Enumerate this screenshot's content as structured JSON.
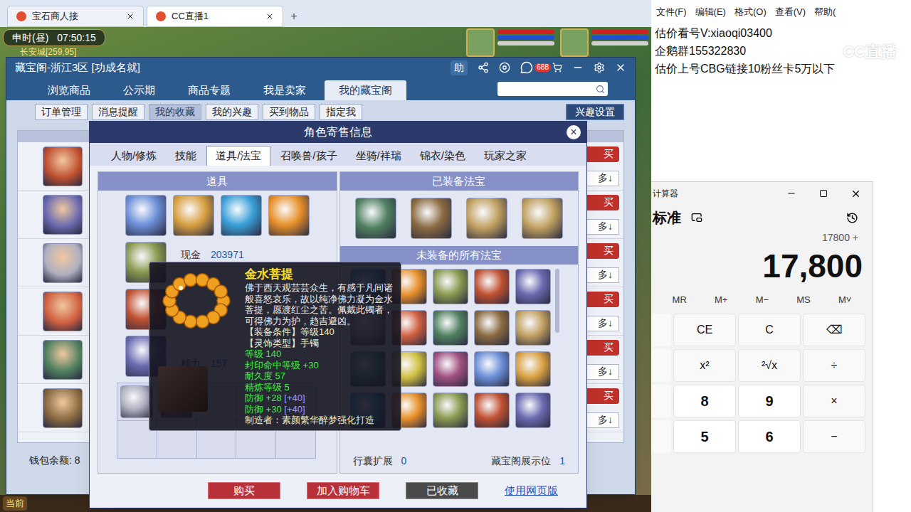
{
  "browser": {
    "tabs": [
      {
        "label": "宝石商人接",
        "selected": false
      },
      {
        "label": "CC直播1",
        "selected": true
      }
    ],
    "new_tab": "+"
  },
  "game_hud": {
    "time": "申时(昼)",
    "clock": "07:50:15",
    "location": "长安城[259,95]"
  },
  "cbg": {
    "title": "藏宝阁-浙江3区 [功成名就]",
    "help": "助",
    "badge": "688",
    "tabs": [
      {
        "label": "浏览商品",
        "selected": false
      },
      {
        "label": "公示期",
        "selected": false
      },
      {
        "label": "商品专题",
        "selected": false
      },
      {
        "label": "我是卖家",
        "selected": false
      },
      {
        "label": "我的藏宝阁",
        "selected": true
      }
    ],
    "subtabs": [
      {
        "label": "订单管理",
        "selected": false
      },
      {
        "label": "消息提醒",
        "selected": false
      },
      {
        "label": "我的收藏",
        "selected": true
      },
      {
        "label": "我的兴趣",
        "selected": false
      },
      {
        "label": "买到物品",
        "selected": false
      },
      {
        "label": "指定我",
        "selected": false
      }
    ],
    "interest_button": "兴趣设置",
    "search": {
      "placeholder": ""
    },
    "rows": [
      {
        "buy": "买",
        "more": "多↓"
      },
      {
        "buy": "买",
        "more": "多↓"
      },
      {
        "buy": "买",
        "more": "多↓"
      },
      {
        "buy": "买",
        "more": "多↓"
      },
      {
        "buy": "买",
        "more": "多↓"
      },
      {
        "buy": "买",
        "more": "多↓"
      }
    ],
    "wallet": "钱包余额: 8"
  },
  "modal": {
    "title": "角色寄售信息",
    "close": "×",
    "tabs": [
      {
        "label": "人物/修炼",
        "selected": false
      },
      {
        "label": "技能",
        "selected": false
      },
      {
        "label": "道具/法宝",
        "selected": true
      },
      {
        "label": "召唤兽/孩子",
        "selected": false
      },
      {
        "label": "坐骑/祥瑞",
        "selected": false
      },
      {
        "label": "锦衣/染色",
        "selected": false
      },
      {
        "label": "玩家之家",
        "selected": false
      }
    ],
    "items_header": "道具",
    "stats": [
      {
        "label": "现金",
        "value": "203971"
      },
      {
        "label": "精力",
        "value": "157"
      }
    ],
    "equipped_header": "已装备法宝",
    "unequipped_header": "未装备的所有法宝",
    "footer": [
      {
        "label": "行囊扩展",
        "value": "0"
      },
      {
        "label": "藏宝阁展示位",
        "value": "1"
      }
    ],
    "buttons": [
      {
        "label": "购买",
        "kind": "primary"
      },
      {
        "label": "加入购物车",
        "kind": "primary"
      },
      {
        "label": "已收藏",
        "kind": "done"
      },
      {
        "label": "使用网页版",
        "kind": "link"
      }
    ]
  },
  "tooltip": {
    "name": "金水菩提",
    "description": "佛于西天观芸芸众生，有感于凡间诸般喜怒哀乐，故以纯净佛力凝为金水菩提，愿渡红尘之苦。佩戴此镯者，可得佛力为护，趋吉避凶。",
    "conditions": [
      "【装备条件】等级140",
      "【灵饰类型】手镯"
    ],
    "stats": [
      {
        "text": "等级 140",
        "color": "#3cf03c",
        "extra": "",
        "extra_color": "#a890ff"
      },
      {
        "text": "封印命中等级 +30",
        "color": "#3cf03c",
        "extra": "",
        "extra_color": "#a890ff"
      },
      {
        "text": "耐久度 57",
        "color": "#3cf03c",
        "extra": "",
        "extra_color": "#a890ff"
      },
      {
        "text": "精炼等级 5",
        "color": "#3cf03c",
        "extra": "",
        "extra_color": "#a890ff"
      },
      {
        "text": "防御 +28",
        "color": "#3cf03c",
        "extra": "[+40]",
        "extra_color": "#a890ff"
      },
      {
        "text": "防御 +30",
        "color": "#3cf03c",
        "extra": "[+40]",
        "extra_color": "#a890ff"
      }
    ],
    "maker": "制造者：素颜繁华醉梦强化打造"
  },
  "taskbar": {
    "left": "当前"
  },
  "notepad": {
    "menu": [
      "文件(F)",
      "编辑(E)",
      "格式(O)",
      "查看(V)",
      "帮助("
    ],
    "lines": [
      "估价看号V:xiaoqi03400",
      "企鹅群155322830",
      "估价上号CBG链接10粉丝卡5万以下"
    ],
    "watermark": "CC直播"
  },
  "calculator": {
    "title": "计算器",
    "mode": "标准",
    "expression": "17800 +",
    "display": "17,800",
    "memory": [
      "MR",
      "M+",
      "M−",
      "MS",
      "M˅"
    ],
    "keys": [
      [
        {
          "label": "CE",
          "kind": "function"
        },
        {
          "label": "C",
          "kind": "function"
        },
        {
          "label": "⌫",
          "kind": "function"
        }
      ],
      [
        {
          "label": "x²",
          "kind": "function"
        },
        {
          "label": "²√x",
          "kind": "function"
        },
        {
          "label": "÷",
          "kind": "function"
        }
      ],
      [
        {
          "label": "8",
          "kind": "digit"
        },
        {
          "label": "9",
          "kind": "digit"
        },
        {
          "label": "×",
          "kind": "function"
        }
      ],
      [
        {
          "label": "5",
          "kind": "digit"
        },
        {
          "label": "6",
          "kind": "digit"
        },
        {
          "label": "−",
          "kind": "function"
        }
      ]
    ]
  }
}
